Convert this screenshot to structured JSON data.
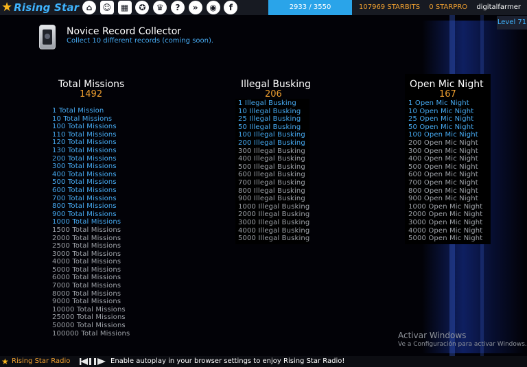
{
  "header": {
    "logo_text": "Rising Star",
    "nav_icons": [
      {
        "name": "home-icon",
        "glyph": "⌂"
      },
      {
        "name": "cow-icon",
        "glyph": "☺"
      },
      {
        "name": "cards-icon",
        "glyph": "▦"
      },
      {
        "name": "ribbon-icon",
        "glyph": "✪"
      },
      {
        "name": "trophy-icon",
        "glyph": "♛"
      },
      {
        "name": "help-icon",
        "glyph": "?"
      },
      {
        "name": "hive-icon",
        "glyph": "»"
      },
      {
        "name": "discord-icon",
        "glyph": "◉"
      },
      {
        "name": "facebook-icon",
        "glyph": "f"
      }
    ],
    "progress_text": "2933 / 3550",
    "progress_value": 2933,
    "progress_max": 3550,
    "starbits": "107969 STARBITS",
    "starpro": "0 STARPRO",
    "username": "digitalfarmer",
    "level": "Level 71"
  },
  "achievement": {
    "title": "Novice Record Collector",
    "description": "Collect 10 different records (coming soon)."
  },
  "columns": [
    {
      "title": "Total Missions",
      "count": "1492",
      "milestones": [
        {
          "label": "1 Total Mission",
          "done": true
        },
        {
          "label": "10 Total Missions",
          "done": true
        },
        {
          "label": "100 Total Missions",
          "done": true
        },
        {
          "label": "110 Total Missions",
          "done": true
        },
        {
          "label": "120 Total Missions",
          "done": true
        },
        {
          "label": "130 Total Missions",
          "done": true
        },
        {
          "label": "200 Total Missions",
          "done": true
        },
        {
          "label": "300 Total Missions",
          "done": true
        },
        {
          "label": "400 Total Missions",
          "done": true
        },
        {
          "label": "500 Total Missions",
          "done": true
        },
        {
          "label": "600 Total Missions",
          "done": true
        },
        {
          "label": "700 Total Missions",
          "done": true
        },
        {
          "label": "800 Total Missions",
          "done": true
        },
        {
          "label": "900 Total Missions",
          "done": true
        },
        {
          "label": "1000 Total Missions",
          "done": true
        },
        {
          "label": "1500 Total Missions",
          "done": false
        },
        {
          "label": "2000 Total Missions",
          "done": false
        },
        {
          "label": "2500 Total Missions",
          "done": false
        },
        {
          "label": "3000 Total Missions",
          "done": false
        },
        {
          "label": "4000 Total Missions",
          "done": false
        },
        {
          "label": "5000 Total Missions",
          "done": false
        },
        {
          "label": "6000 Total Missions",
          "done": false
        },
        {
          "label": "7000 Total Missions",
          "done": false
        },
        {
          "label": "8000 Total Missions",
          "done": false
        },
        {
          "label": "9000 Total Missions",
          "done": false
        },
        {
          "label": "10000 Total Missions",
          "done": false
        },
        {
          "label": "25000 Total Missions",
          "done": false
        },
        {
          "label": "50000 Total Missions",
          "done": false
        },
        {
          "label": "100000 Total Missions",
          "done": false
        }
      ]
    },
    {
      "title": "Illegal Busking",
      "count": "206",
      "milestones": [
        {
          "label": "1 Illegal Busking",
          "done": true
        },
        {
          "label": "10 Illegal Busking",
          "done": true
        },
        {
          "label": "25 Illegal Busking",
          "done": true
        },
        {
          "label": "50 Illegal Busking",
          "done": true
        },
        {
          "label": "100 Illegal Busking",
          "done": true
        },
        {
          "label": "200 Illegal Busking",
          "done": true
        },
        {
          "label": "300 Illegal Busking",
          "done": false
        },
        {
          "label": "400 Illegal Busking",
          "done": false
        },
        {
          "label": "500 Illegal Busking",
          "done": false
        },
        {
          "label": "600 Illegal Busking",
          "done": false
        },
        {
          "label": "700 Illegal Busking",
          "done": false
        },
        {
          "label": "800 Illegal Busking",
          "done": false
        },
        {
          "label": "900 Illegal Busking",
          "done": false
        },
        {
          "label": "1000 Illegal Busking",
          "done": false
        },
        {
          "label": "2000 Illegal Busking",
          "done": false
        },
        {
          "label": "3000 Illegal Busking",
          "done": false
        },
        {
          "label": "4000 Illegal Busking",
          "done": false
        },
        {
          "label": "5000 Illegal Busking",
          "done": false
        }
      ]
    },
    {
      "title": "Open Mic Night",
      "count": "167",
      "milestones": [
        {
          "label": "1 Open Mic Night",
          "done": true
        },
        {
          "label": "10 Open Mic Night",
          "done": true
        },
        {
          "label": "25 Open Mic Night",
          "done": true
        },
        {
          "label": "50 Open Mic Night",
          "done": true
        },
        {
          "label": "100 Open Mic Night",
          "done": true
        },
        {
          "label": "200 Open Mic Night",
          "done": false
        },
        {
          "label": "300 Open Mic Night",
          "done": false
        },
        {
          "label": "400 Open Mic Night",
          "done": false
        },
        {
          "label": "500 Open Mic Night",
          "done": false
        },
        {
          "label": "600 Open Mic Night",
          "done": false
        },
        {
          "label": "700 Open Mic Night",
          "done": false
        },
        {
          "label": "800 Open Mic Night",
          "done": false
        },
        {
          "label": "900 Open Mic Night",
          "done": false
        },
        {
          "label": "1000 Open Mic Night",
          "done": false
        },
        {
          "label": "2000 Open Mic Night",
          "done": false
        },
        {
          "label": "3000 Open Mic Night",
          "done": false
        },
        {
          "label": "4000 Open Mic Night",
          "done": false
        },
        {
          "label": "5000 Open Mic Night",
          "done": false
        }
      ]
    }
  ],
  "watermark": {
    "title": "Activar Windows",
    "subtitle": "Ve a Configuración para activar Windows."
  },
  "radio": {
    "label": "Rising Star Radio",
    "message": "Enable autoplay in your browser settings to enjoy Rising Star Radio!"
  },
  "colors": {
    "accent_blue": "#46aaf2",
    "accent_orange": "#f0a030",
    "done": "#46aaf2",
    "todo": "#9ea2a8"
  }
}
